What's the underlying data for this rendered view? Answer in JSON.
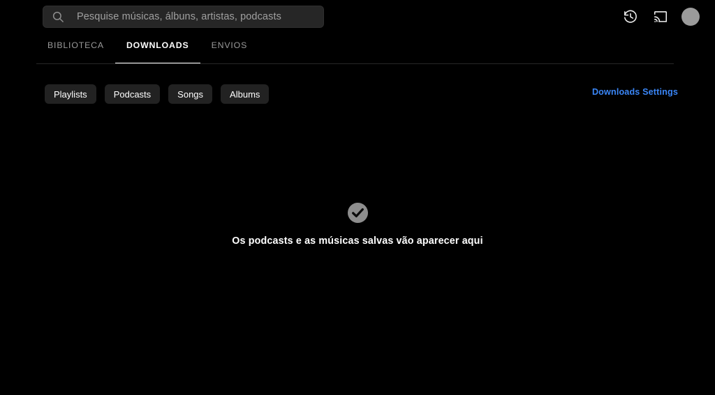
{
  "colors": {
    "background": "#000000",
    "search_field": "#262626",
    "chip_background": "#222222",
    "link_accent": "#3a86f7",
    "avatar": "#9b9b9b",
    "empty_icon": "#8d8d8d",
    "active_tab": "#ffffff",
    "inactive_tab": "#9a9a9a",
    "divider": "#272727"
  },
  "search": {
    "placeholder": "Pesquise músicas, álbuns, artistas, podcasts",
    "value": "",
    "icon": "search-icon"
  },
  "top_actions": [
    {
      "name": "history-icon",
      "label": "Histórico"
    },
    {
      "name": "cast-icon",
      "label": "Transmitir"
    },
    {
      "name": "avatar",
      "label": "Conta"
    }
  ],
  "tabs": [
    {
      "label": "BIBLIOTECA",
      "active": false
    },
    {
      "label": "DOWNLOADS",
      "active": true
    },
    {
      "label": "ENVIOS",
      "active": false
    }
  ],
  "filters": [
    {
      "label": "Playlists"
    },
    {
      "label": "Podcasts"
    },
    {
      "label": "Songs"
    },
    {
      "label": "Albums"
    }
  ],
  "settings_link": {
    "label": "Downloads Settings"
  },
  "empty_state": {
    "icon": "check-circle-icon",
    "message": "Os podcasts e as músicas salvas vão aparecer aqui"
  }
}
